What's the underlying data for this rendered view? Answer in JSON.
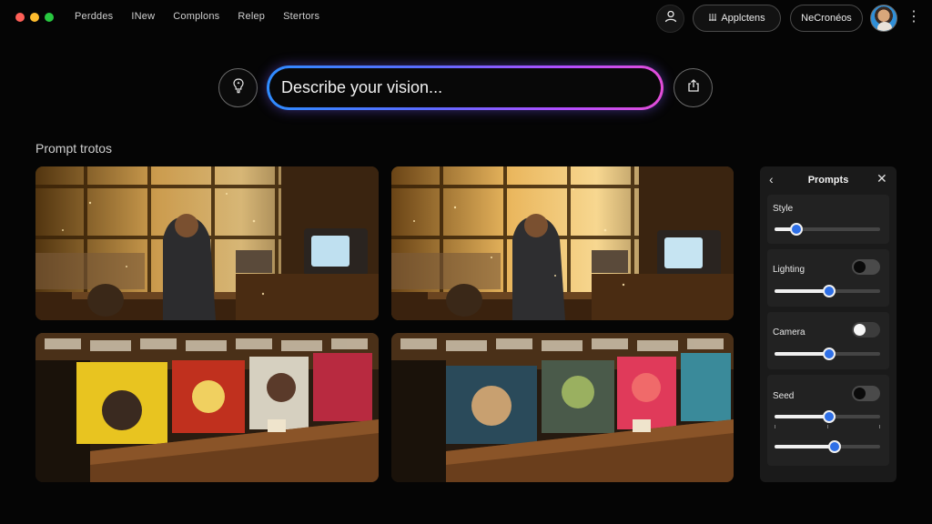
{
  "nav": {
    "items": [
      "Perddes",
      "INew",
      "Complons",
      "Relep",
      "Stertors"
    ]
  },
  "header": {
    "apps_label": "Applctens",
    "new_label": "NeCronéos"
  },
  "prompt": {
    "placeholder": "Describe your vision..."
  },
  "gallery": {
    "title": "Prompt trotos"
  },
  "panel": {
    "title": "Prompts",
    "style_label": "Style",
    "style_value": 0.21,
    "lighting_label": "Lighting",
    "lighting_toggle": "off",
    "lighting_value": 0.52,
    "camera_label": "Camera",
    "camera_toggle": "on",
    "camera_value": 0.52,
    "seed_label": "Seed",
    "seed_toggle": "off",
    "seed_value": 0.52,
    "seed_value_2": 0.57
  },
  "colors": {
    "accent_blue": "#2e6fe6",
    "prompt_gradient_start": "#2f8cff",
    "prompt_gradient_end": "#e24dd8"
  },
  "icons": {
    "profile": "person-icon",
    "apps": "bolt-icon",
    "prompt_left": "lightbulb-icon",
    "prompt_right": "share-icon",
    "menu": "kebab-icon"
  }
}
